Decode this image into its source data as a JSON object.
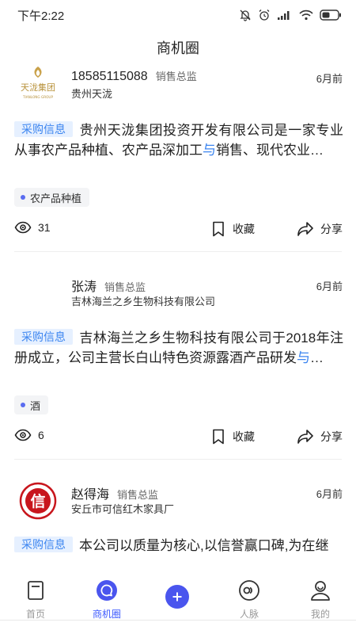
{
  "status_bar": {
    "time": "下午2:22"
  },
  "header": {
    "title": "商机圈"
  },
  "posts": [
    {
      "name": "18585115088",
      "title": "销售总监",
      "company": "贵州天泷",
      "time": "6月前",
      "avatar": "tianlong-group-logo",
      "logo_text": "天泷集团",
      "logo_sub": "TIANLONG GROUP",
      "tag": "采购信息",
      "content_a": "贵州天泷集团投资开发有限公司是一家专业从事农产品种植、农产品深加工",
      "content_hl": "与",
      "content_b": "销售、现代农业…",
      "category": "农产品种植",
      "views": "31",
      "fav_label": "收藏",
      "share_label": "分享"
    },
    {
      "name": "张涛",
      "title": "销售总监",
      "company": "吉林海兰之乡生物科技有限公司",
      "time": "6月前",
      "avatar": "blank-avatar",
      "tag": "采购信息",
      "content_a": "吉林海兰之乡生物科技有限公司于2018年注册成立，公司主营长白山特色资源露酒产品研发",
      "content_hl": "与",
      "content_b": "…",
      "category": "酒",
      "views": "6",
      "fav_label": "收藏",
      "share_label": "分享"
    },
    {
      "name": "赵得海",
      "title": "销售总监",
      "company": "安丘市可信红木家具厂",
      "time": "6月前",
      "avatar": "kexin-seal-logo",
      "logo_text": "信",
      "tag": "采购信息",
      "content_a": "本公司以质量为核心,以信誉赢口碑,为在继"
    }
  ],
  "tab_bar": {
    "items": [
      {
        "label": "首页",
        "icon": "home-doc-icon"
      },
      {
        "label": "商机圈",
        "icon": "chat-bubble-icon"
      },
      {
        "label": "",
        "icon": "plus-icon"
      },
      {
        "label": "人脉",
        "icon": "contacts-icon"
      },
      {
        "label": "我的",
        "icon": "profile-icon"
      }
    ]
  },
  "colors": {
    "accent": "#3d86f0",
    "tab_active": "#3d5afe",
    "tag_bg": "#e6f0ff"
  }
}
